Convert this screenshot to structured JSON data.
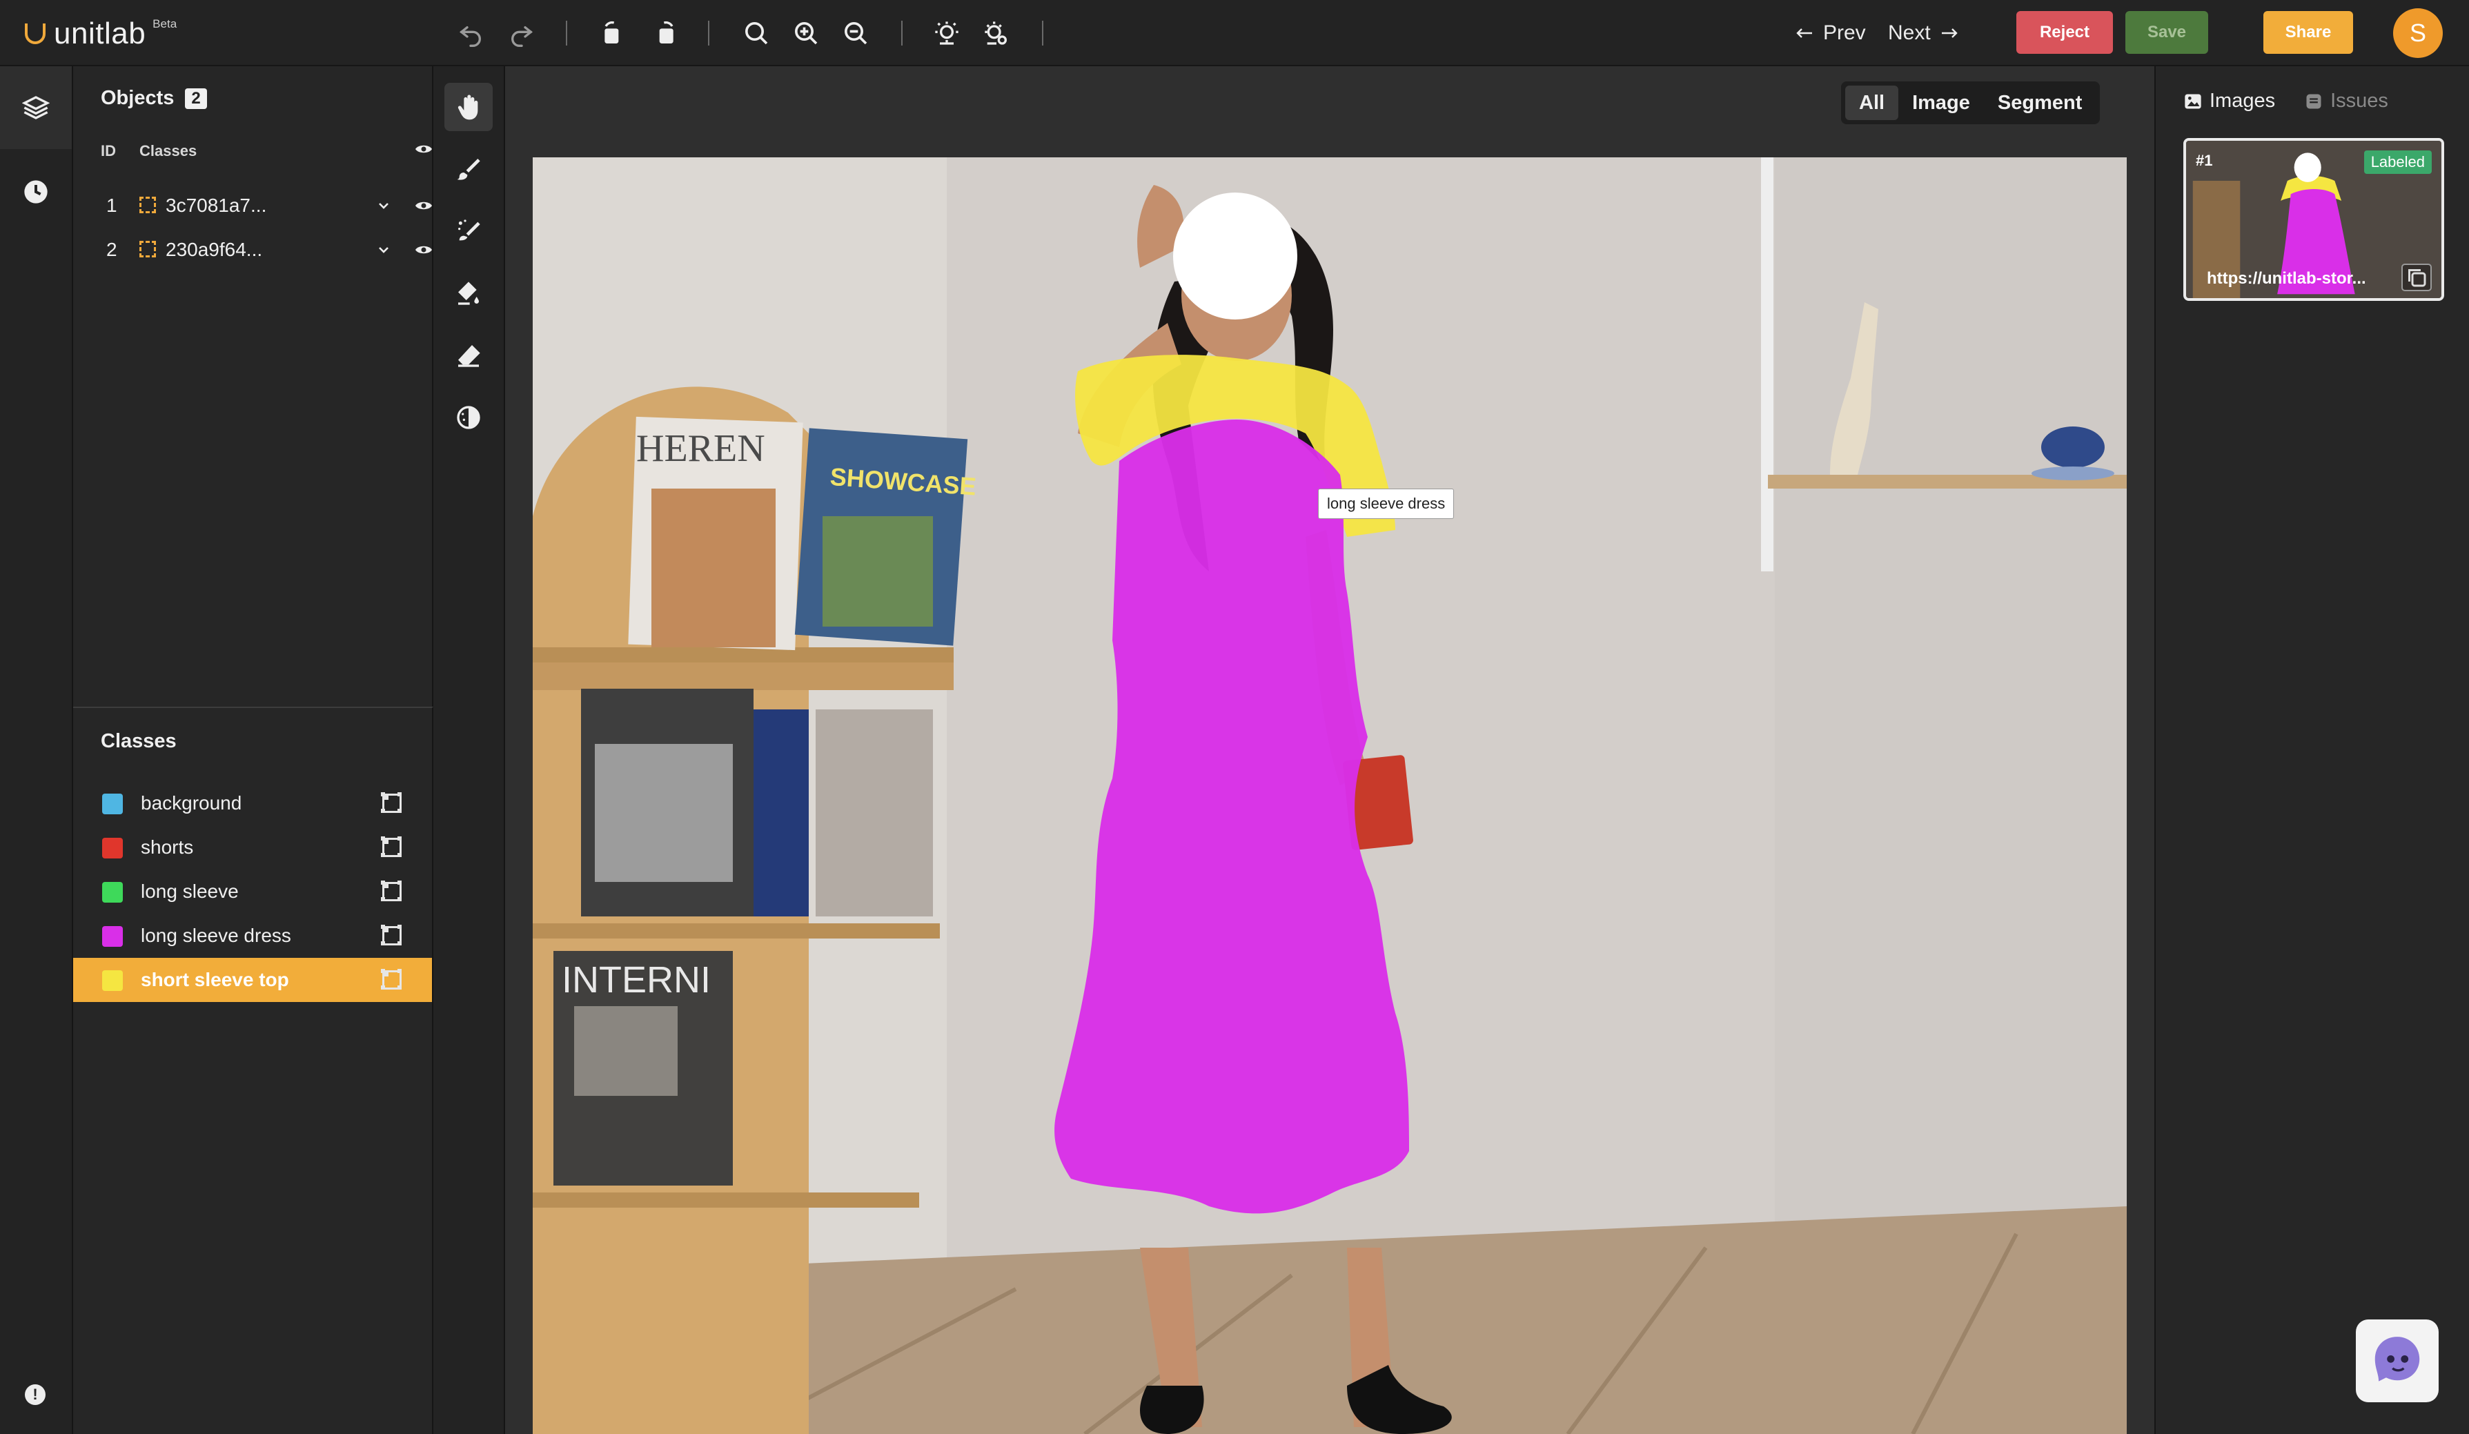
{
  "app": {
    "name": "unitlab",
    "badge": "Beta"
  },
  "toolbar": {
    "icons": [
      "undo-icon",
      "redo-icon",
      "rotate-left-icon",
      "rotate-right-icon",
      "search-icon",
      "zoom-in-icon",
      "zoom-out-icon",
      "brightness-icon",
      "settings-icon"
    ],
    "prev_label": "Prev",
    "next_label": "Next",
    "reject_label": "Reject",
    "save_label": "Save",
    "share_label": "Share",
    "avatar_initial": "S"
  },
  "objects": {
    "title": "Objects",
    "count": "2",
    "col_id": "ID",
    "col_classes": "Classes",
    "items": [
      {
        "id": "1",
        "name": "3c7081a7..."
      },
      {
        "id": "2",
        "name": "230a9f64..."
      }
    ]
  },
  "classes": {
    "title": "Classes",
    "selected": "short sleeve top",
    "items": [
      {
        "label": "background",
        "color": "#4fb6e3"
      },
      {
        "label": "shorts",
        "color": "#e0362c"
      },
      {
        "label": "long sleeve",
        "color": "#3ed95a"
      },
      {
        "label": "long sleeve dress",
        "color": "#d92fe8"
      },
      {
        "label": "short sleeve top",
        "color": "#f5e641"
      }
    ]
  },
  "tools": [
    "hand-icon",
    "brush-icon",
    "smart-brush-icon",
    "fill-icon",
    "eraser-icon",
    "contrast-icon"
  ],
  "view_filter": {
    "tabs": [
      "All",
      "Image",
      "Segment"
    ],
    "active": "All"
  },
  "canvas": {
    "tooltip": "long sleeve dress",
    "magazine_titles": [
      "HEREN",
      "SHOWCASE",
      "INTERNI"
    ],
    "mask_colors": {
      "dress": "#d92fe8",
      "top": "#f5e641"
    }
  },
  "right_panel": {
    "tabs": [
      {
        "label": "Images",
        "active": true
      },
      {
        "label": "Issues",
        "active": false
      }
    ],
    "thumbnail": {
      "number": "#1",
      "status": "Labeled",
      "url": "https://unitlab-stor..."
    }
  }
}
